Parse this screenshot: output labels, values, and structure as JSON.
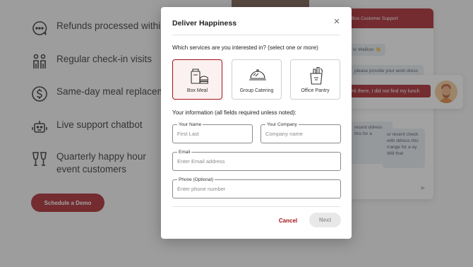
{
  "background": {
    "features": [
      {
        "icon": "refund-chat-icon",
        "text": "Refunds processed within 2"
      },
      {
        "icon": "people-icon",
        "text": "Regular check-in visits"
      },
      {
        "icon": "dollar-icon",
        "text": "Same-day meal replacemer"
      },
      {
        "icon": "robot-icon",
        "text": "Live support chatbot"
      },
      {
        "icon": "glasses-icon",
        "text": "Quarterly happy hour event customers"
      }
    ],
    "demo_button": "Schedule a Demo",
    "chat": {
      "header": "Box Customer Support",
      "greeting": "to WeBox! 👋",
      "message1": "please provide your work dress so we can assist you",
      "user_message": "Hi there, I did not find my lunch",
      "message2": "recent ddress this for a",
      "message3": "ur recent check with ddress this rrange for a ey. Will that"
    }
  },
  "modal": {
    "title": "Deliver Happiness",
    "services_question": "Which services are you interested in? (select one or more)",
    "services": [
      {
        "label": "Box Meal",
        "icon": "box-meal-icon",
        "selected": true
      },
      {
        "label": "Group Catering",
        "icon": "catering-cloche-icon",
        "selected": false
      },
      {
        "label": "Office Pantry",
        "icon": "pantry-bag-icon",
        "selected": false
      }
    ],
    "info_label": "Your information (all fields required unless noted):",
    "fields": {
      "name": {
        "label": "Your Name",
        "placeholder": "First Last",
        "value": ""
      },
      "company": {
        "label": "Your Company",
        "placeholder": "Company name",
        "value": ""
      },
      "email": {
        "label": "Email",
        "placeholder": "Enter Email address",
        "value": ""
      },
      "phone": {
        "label": "Phone (Optional)",
        "placeholder": "Enter phone number",
        "value": ""
      }
    },
    "cancel_label": "Cancel",
    "next_label": "Next",
    "accent_color": "#a2121b"
  }
}
